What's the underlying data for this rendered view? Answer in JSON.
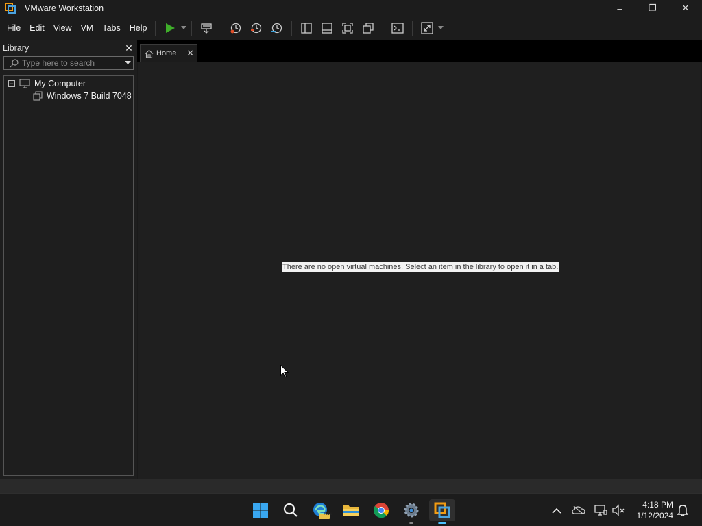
{
  "window": {
    "title": "VMware Workstation",
    "minimize_glyph": "–",
    "restore_glyph": "❐",
    "close_glyph": "✕"
  },
  "menu": {
    "items": [
      "File",
      "Edit",
      "View",
      "VM",
      "Tabs",
      "Help"
    ]
  },
  "toolbar": {
    "icons": [
      "power-on-icon",
      "send-ctrl-alt-del-icon",
      "take-snapshot-icon",
      "revert-snapshot-icon",
      "snapshot-manager-icon",
      "show-library-icon",
      "show-thumbnail-bar-icon",
      "full-screen-icon",
      "unity-icon",
      "console-view-icon",
      "stretch-guest-icon"
    ]
  },
  "library": {
    "title": "Library",
    "close_glyph": "✕",
    "search_placeholder": "Type here to search",
    "tree": {
      "root_label": "My Computer",
      "expander": "−",
      "children": [
        "Windows 7 Build 7048"
      ]
    }
  },
  "tabs": {
    "home_label": "Home",
    "close_glyph": "✕"
  },
  "home": {
    "empty_message": "There are no open virtual machines. Select an item in the library to open it in a tab."
  },
  "taskbar": {
    "apps": [
      "start-icon",
      "search-icon",
      "edge-preview-icon",
      "file-explorer-icon",
      "chrome-icon",
      "settings-icon",
      "vmware-icon"
    ],
    "edge_badge": "PRE",
    "active_app": "vmware-icon",
    "clock_time": "4:18 PM",
    "clock_date": "1/12/2024"
  },
  "colors": {
    "accent": "#4cc2ff",
    "power_green": "#3fae2a",
    "snapshot_red": "#e0502a",
    "snapshot_blue": "#3b9fd8"
  }
}
